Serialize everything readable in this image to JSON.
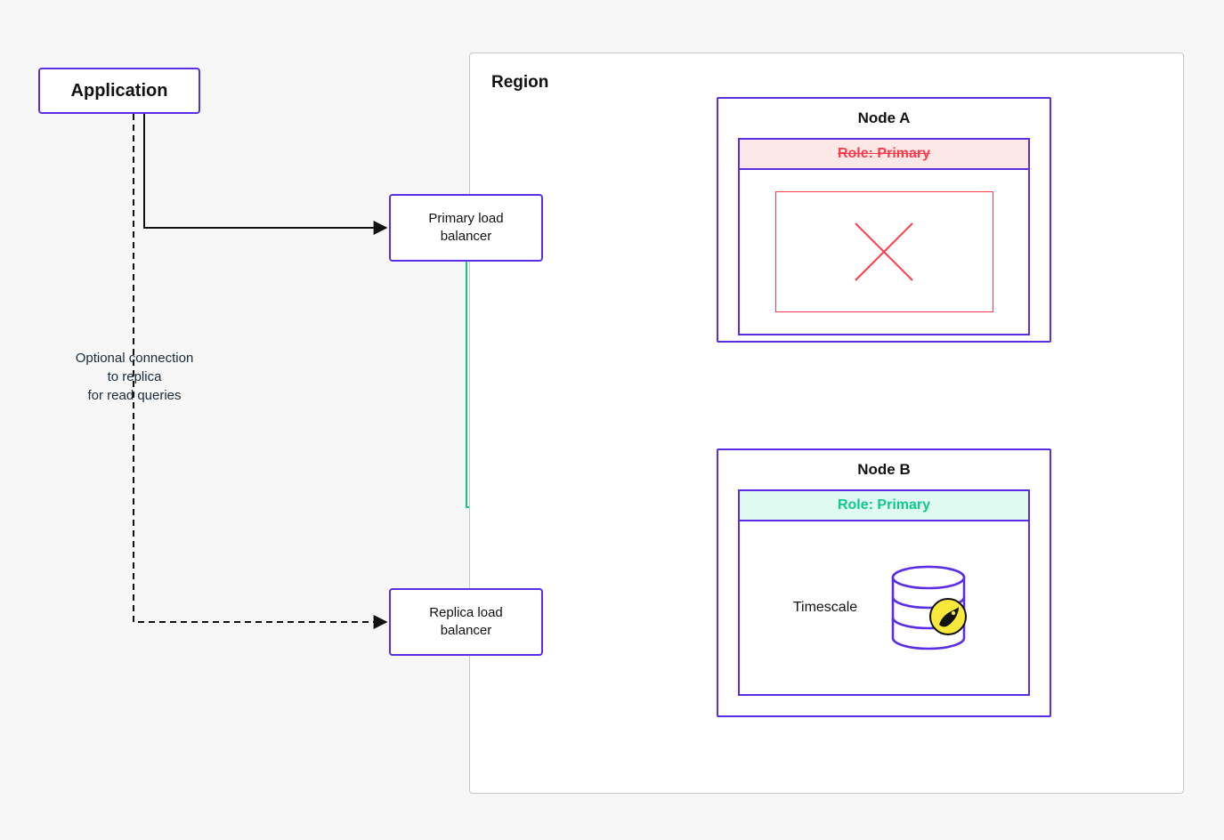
{
  "application": {
    "label": "Application"
  },
  "primary_lb": {
    "label": "Primary load\nbalancer"
  },
  "replica_lb": {
    "label": "Replica load\nbalancer"
  },
  "region": {
    "label": "Region"
  },
  "node_a": {
    "title": "Node A",
    "role_label": "Role: Primary",
    "status": "failed"
  },
  "node_b": {
    "title": "Node B",
    "role_label": "Role: Primary",
    "status": "ok",
    "db_label": "Timescale"
  },
  "optional_text": "Optional connection\nto replica\nfor read queries",
  "colors": {
    "accent": "#5b2ee6",
    "error": "#ff3b4a",
    "success": "#12c78f",
    "success_bg": "#defaf1",
    "error_bg": "#fde8e8"
  },
  "connections": [
    {
      "from": "application",
      "to": "primary_lb",
      "style": "solid",
      "color": "#111",
      "broken": false
    },
    {
      "from": "application",
      "to": "replica_lb",
      "style": "dashed",
      "color": "#111",
      "broken": false,
      "note": "optional read"
    },
    {
      "from": "primary_lb",
      "to": "node_a",
      "style": "solid",
      "color": "#ff3b4a",
      "broken": true
    },
    {
      "from": "primary_lb",
      "to": "node_b",
      "style": "solid",
      "color": "#12c78f",
      "broken": false
    },
    {
      "from": "replica_lb",
      "to": "node_b",
      "style": "solid",
      "color": "#ff3b4a",
      "broken": true
    },
    {
      "from": "node_a",
      "to": "node_b",
      "style": "solid",
      "color": "#ff3b4a",
      "broken": true
    }
  ]
}
